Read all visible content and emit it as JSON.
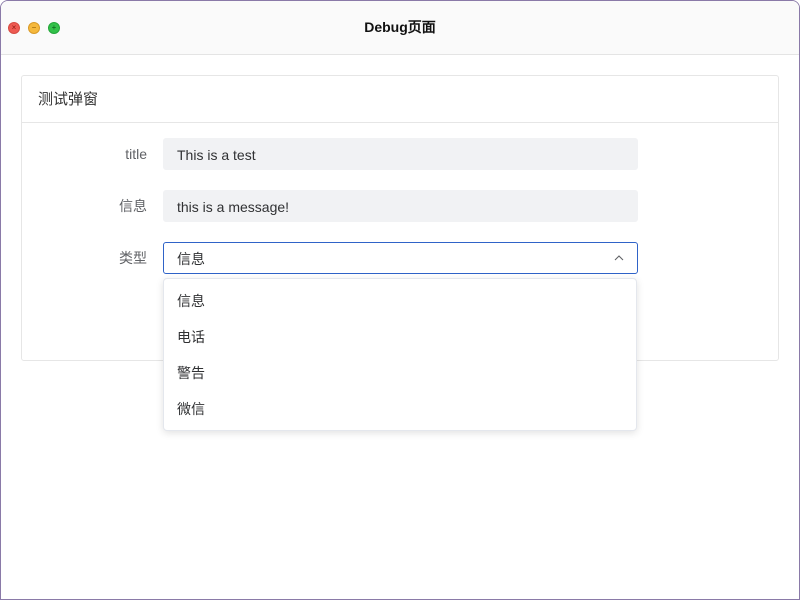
{
  "window": {
    "title": "Debug页面",
    "controls": {
      "close_icon": "close-icon",
      "minimize_icon": "minimize-icon",
      "maximize_icon": "maximize-icon"
    }
  },
  "card": {
    "title": "测试弹窗"
  },
  "form": {
    "title_label": "title",
    "title_value": "This is a test",
    "message_label": "信息",
    "message_value": "this is a message!",
    "type_label": "类型",
    "type_value": "信息",
    "type_icon": "chevron-up-icon",
    "type_options": [
      "信息",
      "电话",
      "警告",
      "微信"
    ]
  },
  "colors": {
    "accent": "#2f63c8",
    "readonly_bg": "#f1f2f4"
  }
}
